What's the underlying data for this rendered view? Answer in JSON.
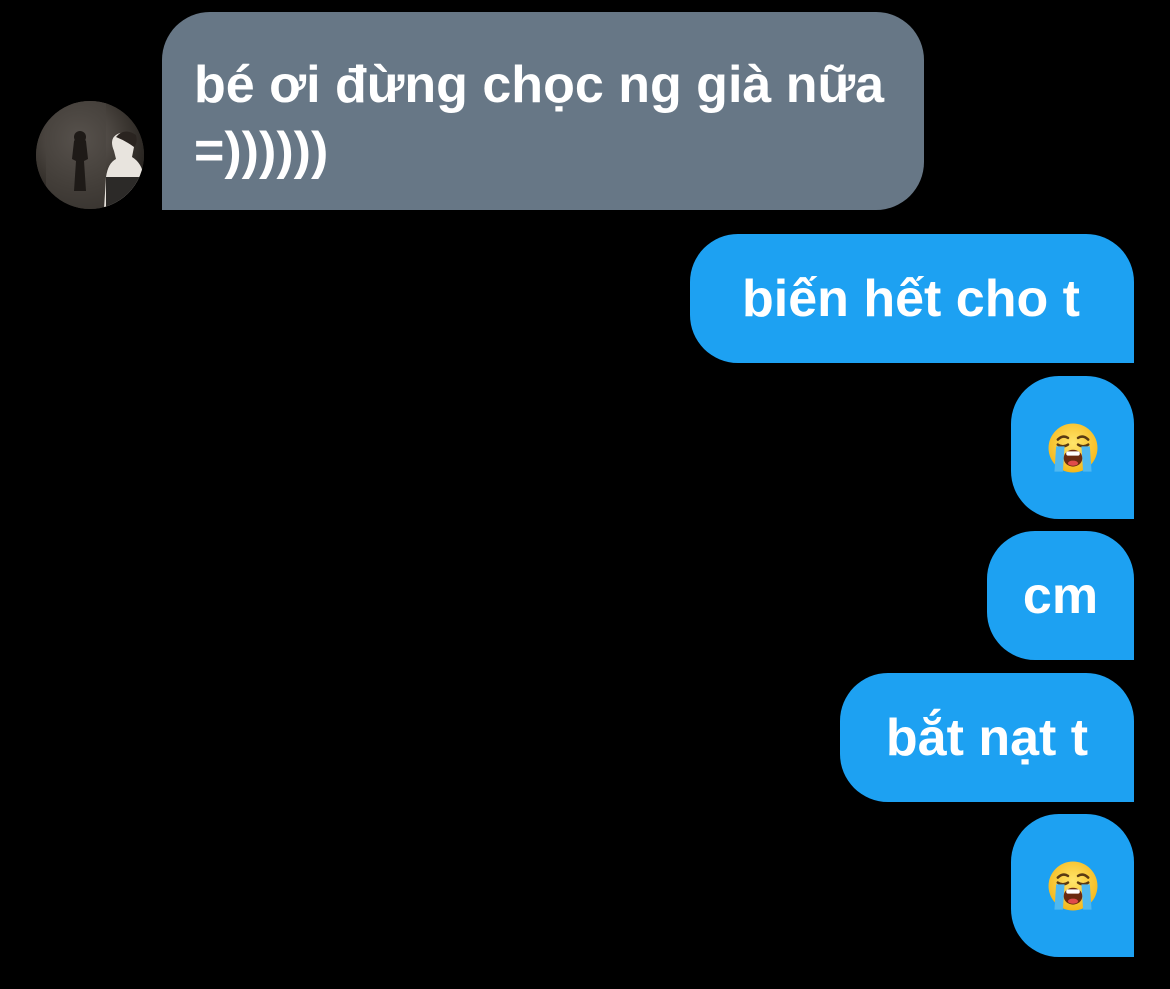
{
  "colors": {
    "background": "#000000",
    "incoming_bubble": "#677786",
    "outgoing_bubble": "#1da1f2",
    "text": "#ffffff"
  },
  "messages": [
    {
      "direction": "incoming",
      "text": "bé ơi đừng chọc ng già nữa =))))))",
      "avatar_icon": "profile-photo-avatar"
    },
    {
      "direction": "outgoing",
      "text": "biến hết cho t"
    },
    {
      "direction": "outgoing",
      "emoji": "loudly-crying-face-icon"
    },
    {
      "direction": "outgoing",
      "text": "cm"
    },
    {
      "direction": "outgoing",
      "text": "bắt nạt t"
    },
    {
      "direction": "outgoing",
      "emoji": "loudly-crying-face-icon"
    }
  ]
}
